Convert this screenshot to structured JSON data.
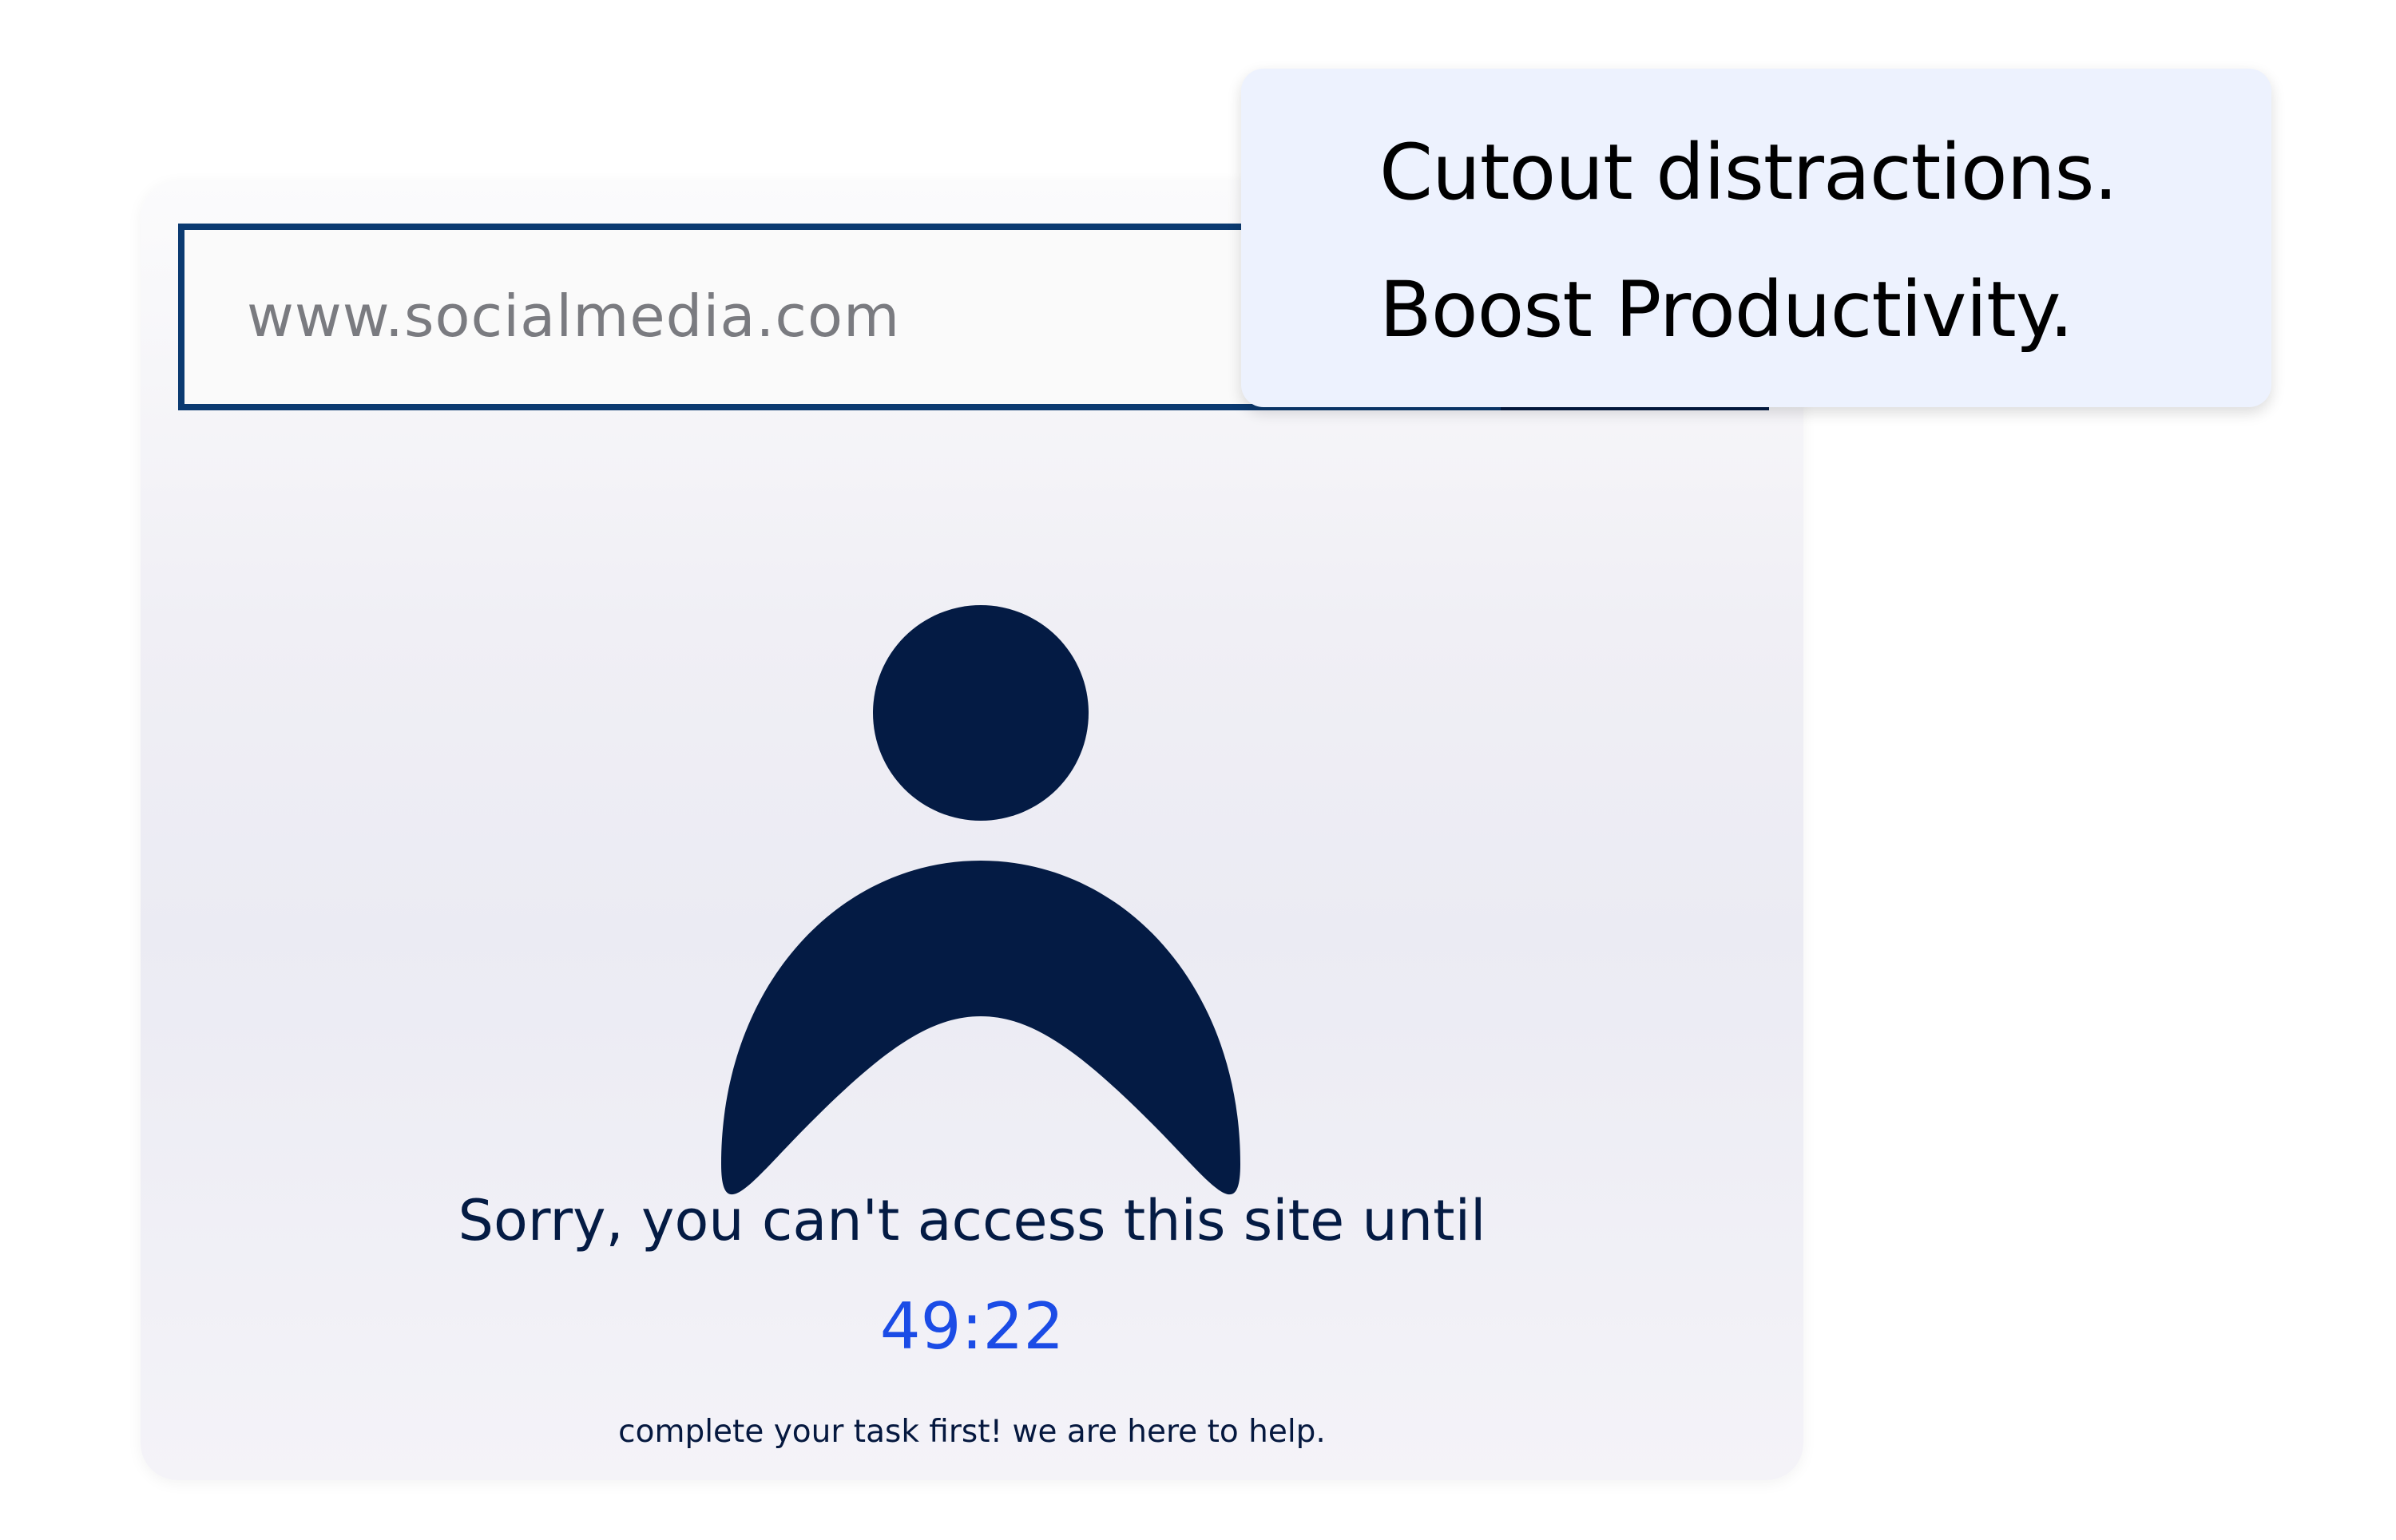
{
  "address_bar": {
    "url": "www.socialmedia.com"
  },
  "promo": {
    "line_one": "Cutout distractions.",
    "line_two": "Boost Productivity."
  },
  "blocked_page": {
    "icon": "person-icon",
    "message": "Sorry, you can't access this site until",
    "countdown": "49:22",
    "help_text": "complete your task first! we are here to help."
  },
  "colors": {
    "navy": "#041b44",
    "address_border": "#0b3a71",
    "countdown": "#1b4ce6",
    "promo_background": "#edf2fe"
  }
}
